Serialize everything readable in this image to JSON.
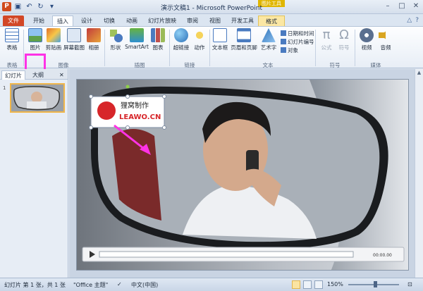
{
  "app": {
    "title": "演示文稿1 - Microsoft PowerPoint",
    "contextual_header": "图片工具"
  },
  "tabs": [
    {
      "label": "文件"
    },
    {
      "label": "开始"
    },
    {
      "label": "插入"
    },
    {
      "label": "设计"
    },
    {
      "label": "切换"
    },
    {
      "label": "动画"
    },
    {
      "label": "幻灯片放映"
    },
    {
      "label": "审阅"
    },
    {
      "label": "视图"
    },
    {
      "label": "开发工具"
    },
    {
      "label": "格式"
    }
  ],
  "ribbon": {
    "table": "表格",
    "picture": "图片",
    "clipart": "剪贴画",
    "screenshot": "屏幕截图",
    "album": "相册",
    "shapes": "形状",
    "smartart": "SmartArt",
    "chart": "图表",
    "hyperlink": "超链接",
    "action": "动作",
    "textbox": "文本框",
    "header_footer": "页眉和页脚",
    "wordart": "艺术字",
    "datetime": "日期和时间",
    "slide_number": "幻灯片编号",
    "object": "对象",
    "equation": "公式",
    "symbol": "符号",
    "video": "视频",
    "audio": "音频",
    "groups": {
      "tables": "表格",
      "images": "图像",
      "illustrations": "插图",
      "links": "链接",
      "text": "文本",
      "symbols": "符号",
      "media": "媒体"
    }
  },
  "panel": {
    "tab_slides": "幻灯片",
    "tab_outline": "大纲",
    "slide_number": "1"
  },
  "slide": {
    "logo_cn": "狸窝制作",
    "logo_en": "LEAWO.CN",
    "video_time": "00:00.00"
  },
  "status": {
    "slide_info": "幻灯片 第 1 张，共 1 张",
    "theme": "\"Office 主题\"",
    "language": "中文(中国)",
    "zoom": "150%"
  },
  "colors": {
    "file_tab": "#d24726",
    "highlight": "#ff32e6",
    "contextual_tools": "#e0b600"
  }
}
